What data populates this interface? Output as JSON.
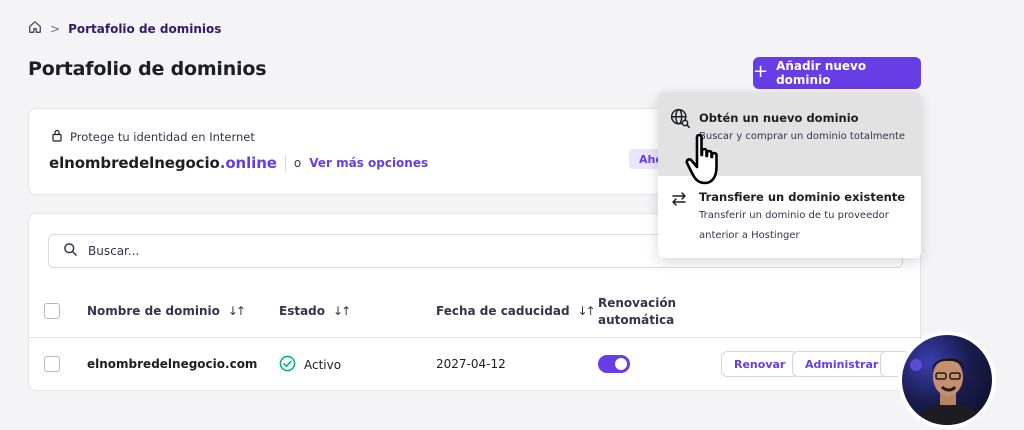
{
  "breadcrumb": {
    "current": "Portafolio de dominios",
    "separator": ">"
  },
  "page": {
    "title": "Portafolio de dominios"
  },
  "add_button": {
    "label": "Añadir nuevo dominio"
  },
  "promo": {
    "protect_text": "Protege tu identidad en Internet",
    "domain_base": "elnombredelnegocio",
    "domain_tld": ".online",
    "or": "o",
    "more_options": "Ver más opciones",
    "badge_visible": "Aho"
  },
  "search": {
    "placeholder": "Buscar..."
  },
  "table": {
    "columns": {
      "name": "Nombre de dominio",
      "status": "Estado",
      "expiry": "Fecha de caducidad",
      "renew_line1": "Renovación",
      "renew_line2": "automática"
    },
    "rows": [
      {
        "domain": "elnombredelnegocio.com",
        "status": "Activo",
        "expiry": "2027-04-12",
        "auto_renew": true,
        "renew_label": "Renovar",
        "manage_label": "Administrar"
      }
    ]
  },
  "dropdown": {
    "items": [
      {
        "title": "Obtén un nuevo dominio",
        "desc": "Buscar y comprar un dominio totalmente"
      },
      {
        "title": "Transfiere un dominio existente",
        "desc": "Transferir un dominio de tu proveedor anterior a Hostinger"
      }
    ]
  },
  "colors": {
    "accent": "#673de6",
    "success": "#00b090",
    "text": "#1d1e20"
  },
  "icons": {
    "home": "home-icon",
    "lock": "lock-icon",
    "search": "search-icon",
    "globe": "globe-search-icon",
    "transfer": "transfer-arrows-icon",
    "check": "check-circle-icon"
  }
}
